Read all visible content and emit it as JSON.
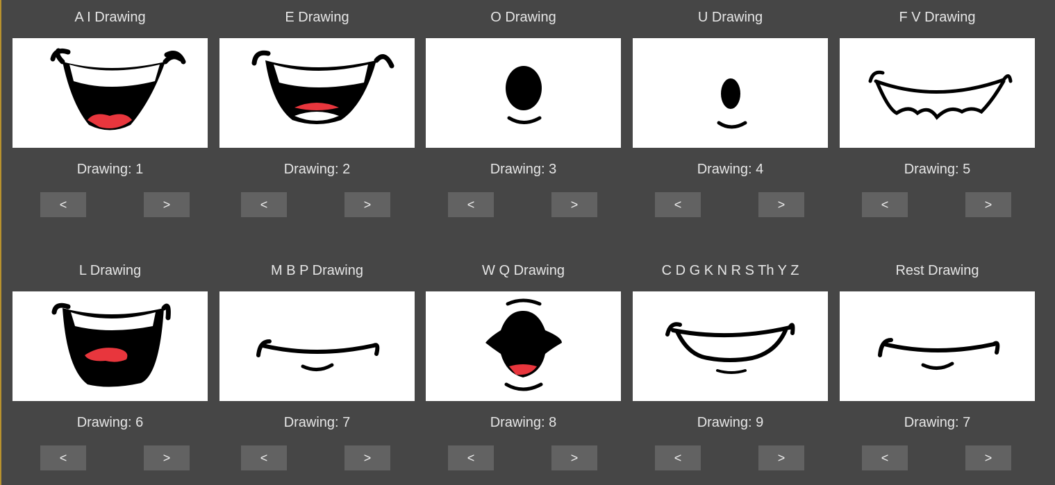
{
  "colors": {
    "background": "#464646",
    "thumb_bg": "#ffffff",
    "button_bg": "#626262",
    "text": "#e6e6e6",
    "mouth": "#000000",
    "tongue": "#e8363d"
  },
  "cells": [
    {
      "title": "A I Drawing",
      "drawing_label": "Drawing: 1",
      "prev_label": "<",
      "next_label": ">",
      "mouth": "wide-open-smile-with-tongue"
    },
    {
      "title": "E Drawing",
      "drawing_label": "Drawing: 2",
      "prev_label": "<",
      "next_label": ">",
      "mouth": "open-smile-teeth"
    },
    {
      "title": "O Drawing",
      "drawing_label": "Drawing: 3",
      "prev_label": "<",
      "next_label": ">",
      "mouth": "round-o"
    },
    {
      "title": "U Drawing",
      "drawing_label": "Drawing: 4",
      "prev_label": "<",
      "next_label": ">",
      "mouth": "small-o"
    },
    {
      "title": "F V Drawing",
      "drawing_label": "Drawing: 5",
      "prev_label": "<",
      "next_label": ">",
      "mouth": "bite-lip"
    },
    {
      "title": "L Drawing",
      "drawing_label": "Drawing: 6",
      "prev_label": "<",
      "next_label": ">",
      "mouth": "open-tongue-up"
    },
    {
      "title": "M B P Drawing",
      "drawing_label": "Drawing: 7",
      "prev_label": "<",
      "next_label": ">",
      "mouth": "closed-line"
    },
    {
      "title": "W Q Drawing",
      "drawing_label": "Drawing: 8",
      "prev_label": "<",
      "next_label": ">",
      "mouth": "pursed-open"
    },
    {
      "title": "C D G K N R S Th Y Z",
      "drawing_label": "Drawing: 9",
      "prev_label": "<",
      "next_label": ">",
      "mouth": "closed-smile"
    },
    {
      "title": "Rest Drawing",
      "drawing_label": "Drawing: 7",
      "prev_label": "<",
      "next_label": ">",
      "mouth": "closed-line"
    }
  ]
}
